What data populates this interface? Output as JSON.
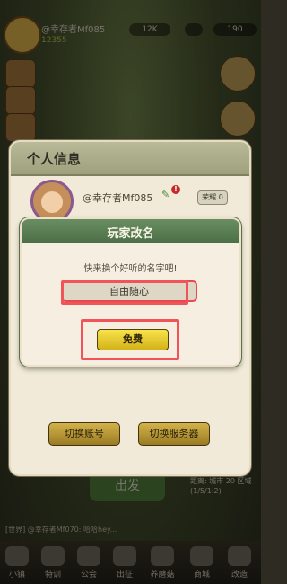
{
  "hud": {
    "player_name": "@幸存者Mf085",
    "level": "12355",
    "pill_a": "12K",
    "pill_b": "",
    "pill_c": "190"
  },
  "info_panel": {
    "title": "个人信息",
    "player_name": "@幸存者Mf085",
    "badge": "荣耀 0",
    "switch_account": "切换账号",
    "switch_server": "切换服务器"
  },
  "rename_dialog": {
    "title": "玩家改名",
    "prompt": "快来换个好听的名字吧!",
    "input_value": "自由随心",
    "free_button": "免费"
  },
  "background": {
    "go_button": "出发",
    "chat_line": "[世界] @幸存者Mf070: 哈哈hey...",
    "notice": "距离: 城市 20\n区域 (1/5/1:2)"
  },
  "bottom_nav": [
    {
      "label": "小镇"
    },
    {
      "label": "特训"
    },
    {
      "label": "公会"
    },
    {
      "label": "出征"
    },
    {
      "label": "养蘑菇"
    },
    {
      "label": "商城"
    },
    {
      "label": "改造"
    }
  ]
}
